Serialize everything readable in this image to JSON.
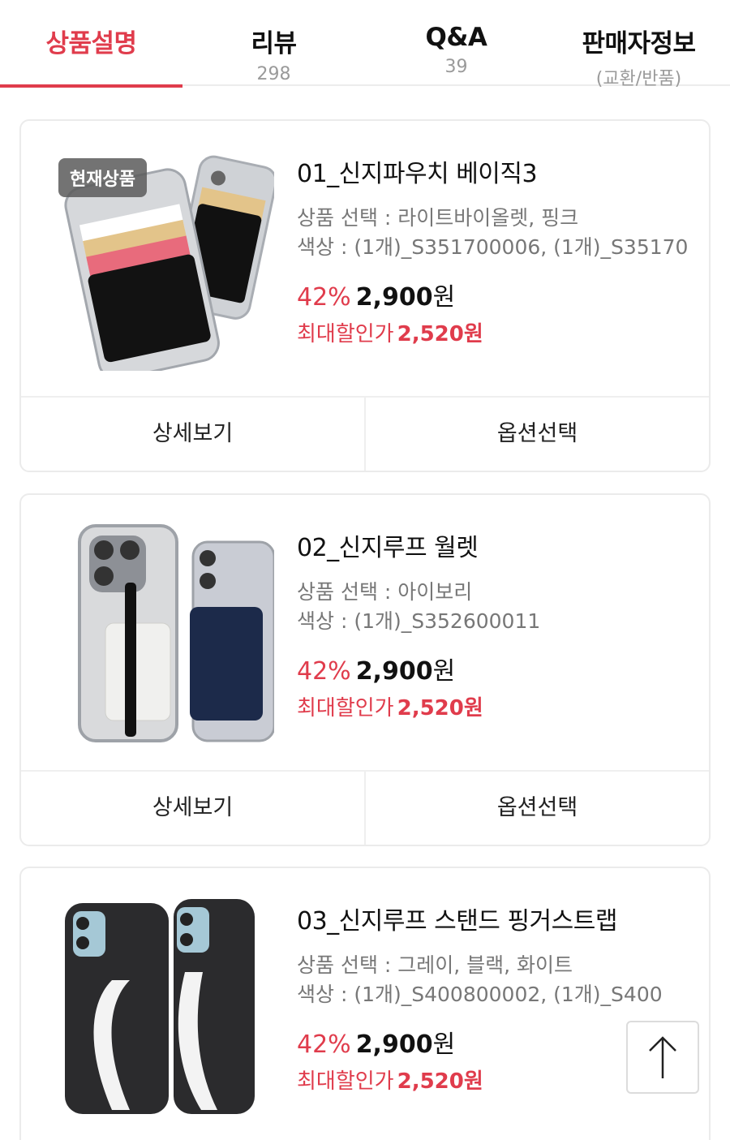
{
  "tabs": [
    {
      "label": "상품설명",
      "sub": ""
    },
    {
      "label": "리뷰",
      "sub": "298"
    },
    {
      "label": "Q&A",
      "sub": "39"
    },
    {
      "label": "판매자정보",
      "sub": "(교환/반품)"
    }
  ],
  "products": [
    {
      "badge": "현재상품",
      "name": "01_신지파우치 베이직3",
      "option_line": "상품 선택 : 라이트바이올렛, 핑크",
      "color_line": "색상 : (1개)_S351700006, (1개)_S35170",
      "discount": "42%",
      "price": "2,900",
      "won": "원",
      "max_label": "최대할인가",
      "max_price": "2,520원",
      "detail_label": "상세보기",
      "option_label": "옵션선택"
    },
    {
      "name": "02_신지루프 월렛",
      "option_line": "상품 선택 : 아이보리",
      "color_line": "색상 : (1개)_S352600011",
      "discount": "42%",
      "price": "2,900",
      "won": "원",
      "max_label": "최대할인가",
      "max_price": "2,520원",
      "detail_label": "상세보기",
      "option_label": "옵션선택"
    },
    {
      "name": "03_신지루프 스탠드 핑거스트랩",
      "option_line": "상품 선택 : 그레이, 블랙, 화이트",
      "color_line": "색상 : (1개)_S400800002, (1개)_S400",
      "discount": "42%",
      "price": "2,900",
      "won": "원",
      "max_label": "최대할인가",
      "max_price": "2,520원"
    }
  ],
  "colors": {
    "accent": "#e03c4c",
    "text": "#111111",
    "muted": "#777777"
  },
  "icons": {
    "scroll_top": "arrow-up-icon"
  }
}
